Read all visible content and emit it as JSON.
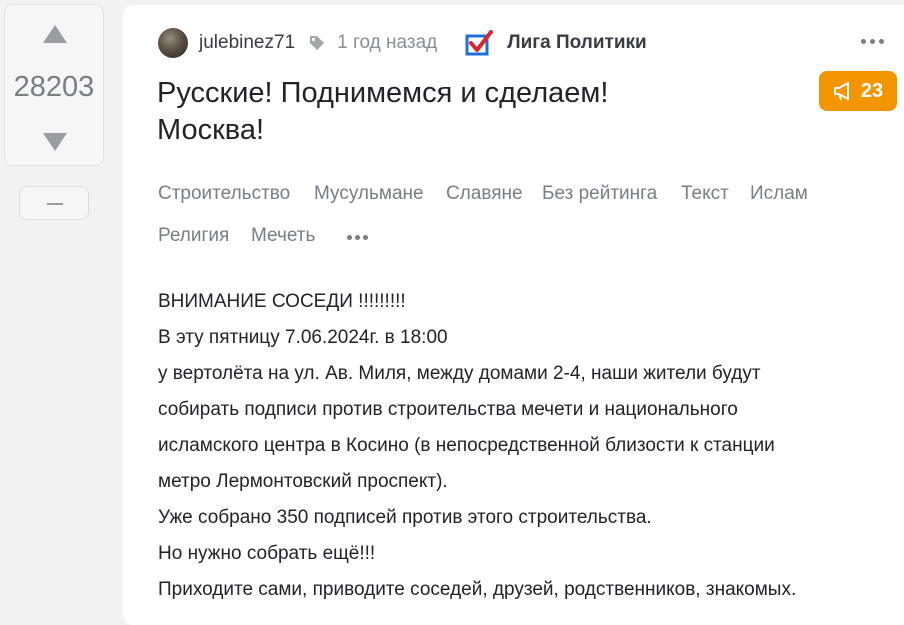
{
  "vote": {
    "rating": "28203",
    "up_icon": "arrow-up-icon",
    "down_icon": "arrow-down-icon",
    "collapse_icon": "minus-icon"
  },
  "post": {
    "author": "julebinez71",
    "time": "1 год назад",
    "community": "Лига Политики",
    "title_lines": [
      "Русские! Поднимемся и сделаем!",
      "Москва!"
    ],
    "badge_count": "23",
    "badge_icon": "megaphone-icon",
    "tags": [
      "Строительство",
      "Мусульмане",
      "Славяне",
      "Без рейтинга",
      "Текст",
      "Ислам",
      "Религия",
      "Мечеть"
    ],
    "body_lines": [
      "ВНИМАНИЕ СОСЕДИ !!!!!!!!!",
      "В эту пятницу 7.06.2024г. в 18:00",
      "у вертолёта на ул. Ав. Миля, между домами 2-4, наши жители будут",
      "собирать подписи против строительства мечети и национального",
      "исламского центра в Косино (в непосредственной близости к станции",
      "метро Лермонтовский проспект).",
      "Уже собрано 350 подписей против этого строительства.",
      "Но нужно собрать ещё!!!",
      "Приходите сами, приводите соседей, друзей, родственников, знакомых."
    ]
  },
  "colors": {
    "accent": "#f39500",
    "community_check": "#1e6fd9",
    "community_cross": "#d9262e"
  }
}
